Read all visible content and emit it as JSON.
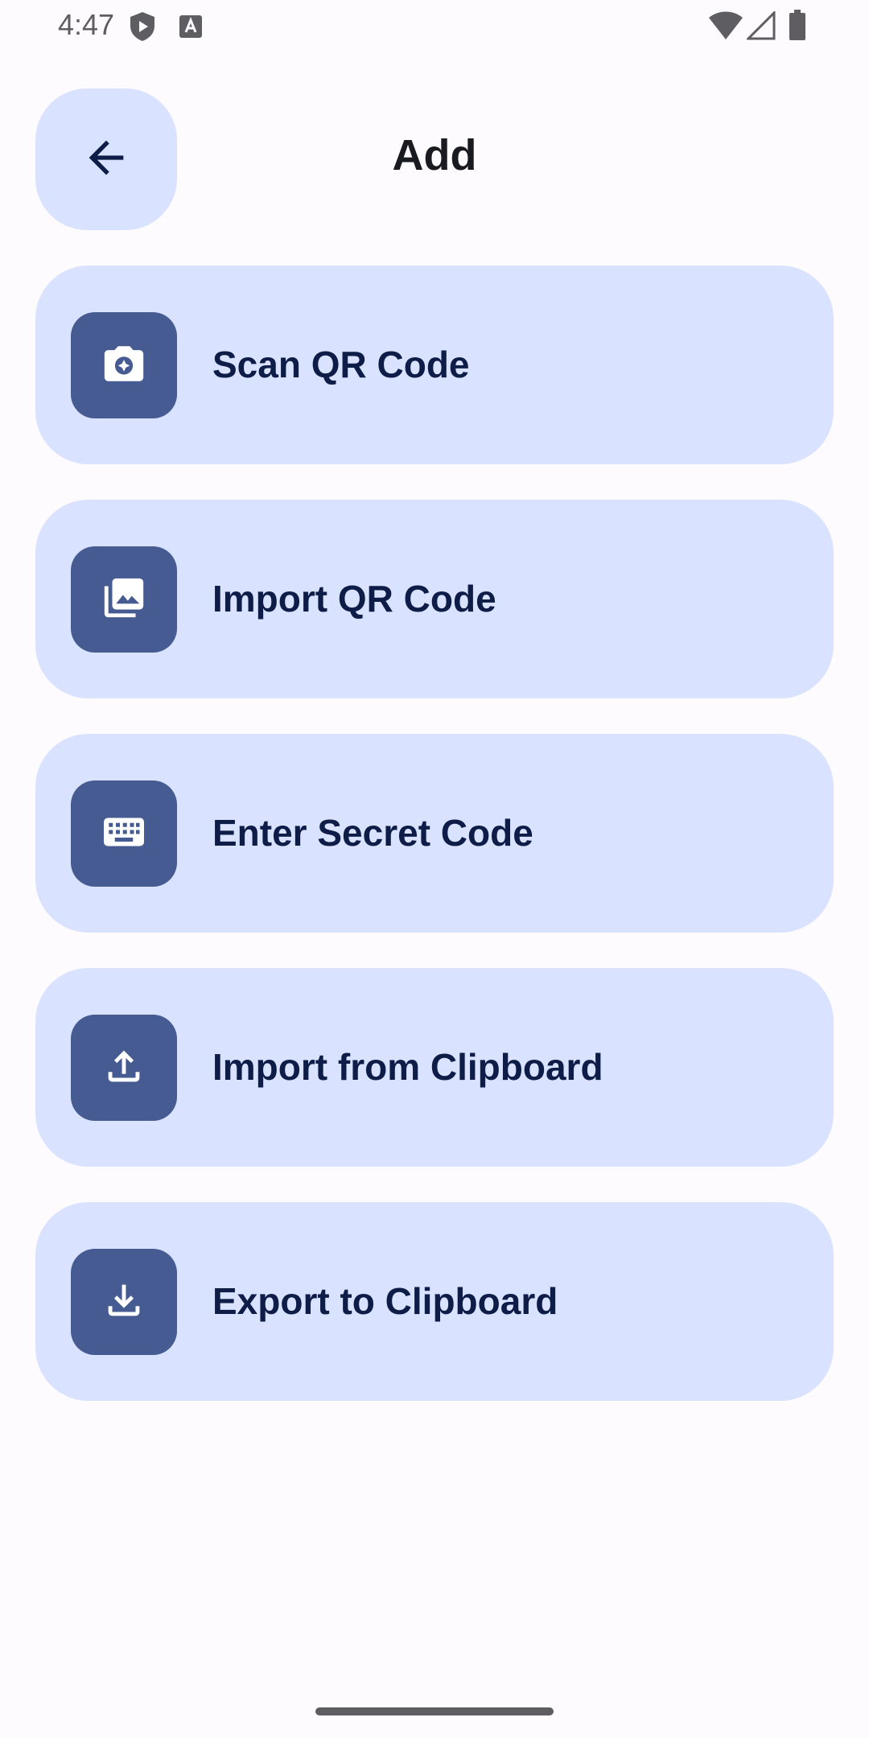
{
  "status_bar": {
    "time": "4:47",
    "icons": [
      "shield-play-icon",
      "text-a-icon",
      "wifi-icon",
      "cellular-signal-icon",
      "battery-icon"
    ]
  },
  "header": {
    "title": "Add",
    "back_icon": "arrow-left-icon"
  },
  "actions": [
    {
      "label": "Scan QR Code",
      "icon": "camera-icon"
    },
    {
      "label": "Import QR Code",
      "icon": "image-gallery-icon"
    },
    {
      "label": "Enter Secret Code",
      "icon": "keyboard-icon"
    },
    {
      "label": "Import from Clipboard",
      "icon": "upload-icon"
    },
    {
      "label": "Export to Clipboard",
      "icon": "download-icon"
    }
  ],
  "colors": {
    "background": "#fdfbfe",
    "card": "#d9e2ff",
    "icon_box": "#455b92",
    "label": "#0e1c48",
    "title": "#1a1b20"
  }
}
